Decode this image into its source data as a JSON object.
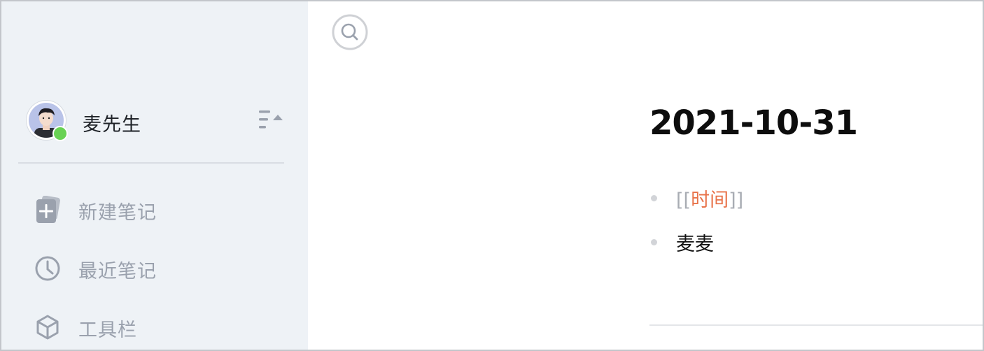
{
  "sidebar": {
    "user": {
      "name": "麦先生",
      "status_color": "#68d253"
    },
    "menu": [
      {
        "label": "新建笔记",
        "icon": "new-note-icon"
      },
      {
        "label": "最近笔记",
        "icon": "clock-icon"
      },
      {
        "label": "工具栏",
        "icon": "cube-icon"
      }
    ]
  },
  "content": {
    "title": "2021-10-31",
    "bullets": [
      {
        "prefix": "[[",
        "link": "时间",
        "suffix": "]]"
      },
      {
        "text": "麦麦"
      }
    ]
  },
  "colors": {
    "sidebar_bg": "#eef2f6",
    "muted": "#9aa1ad",
    "link": "#e8734a",
    "online": "#68d253"
  }
}
